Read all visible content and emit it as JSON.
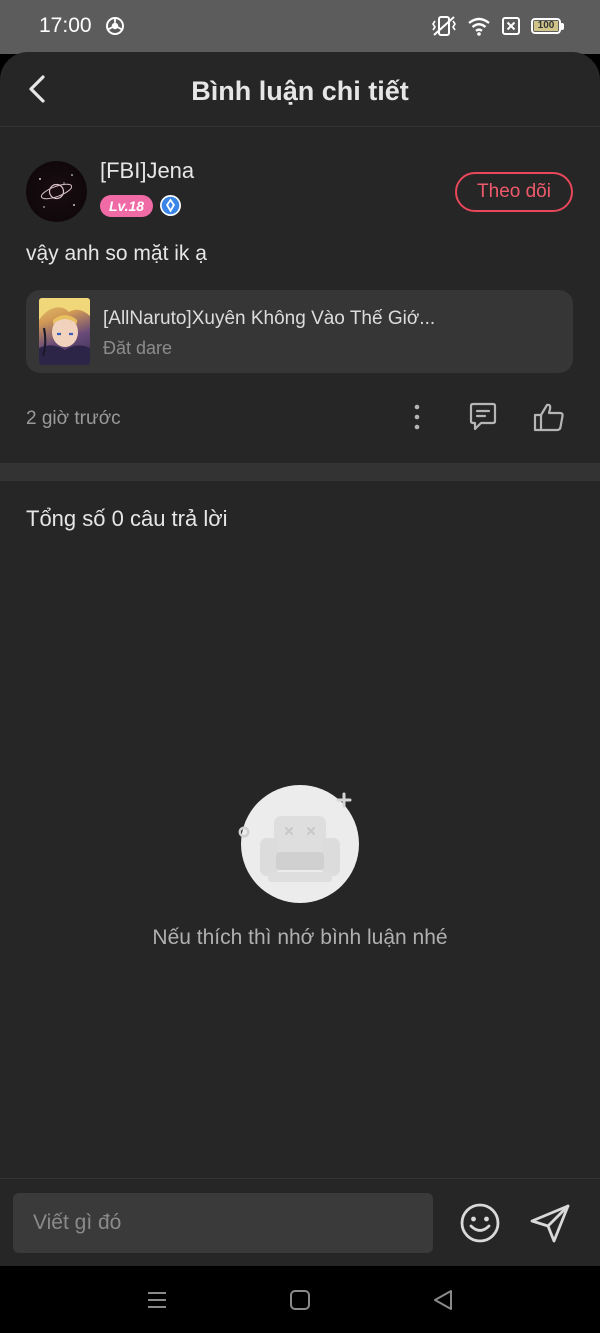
{
  "status_bar": {
    "time": "17:00",
    "battery": "100",
    "icons": [
      "chrome-icon",
      "vibrate-icon",
      "wifi-icon",
      "sim-blocked-icon",
      "battery-icon"
    ]
  },
  "header": {
    "title": "Bình luận chi tiết",
    "back_icon": "back-arrow-icon"
  },
  "comment": {
    "username": "[FBI]Jena",
    "level": "Lv.18",
    "follow_label": "Theo dõi",
    "text": "vậy anh so mặt ik ạ",
    "book": {
      "title": "[AllNaruto]Xuyên Không Vào Thế Giớ...",
      "subtitle": "Đăt dare"
    },
    "time_ago": "2 giờ trước",
    "actions": [
      "more-options-icon",
      "reply-icon",
      "like-icon"
    ]
  },
  "replies": {
    "count_label": "Tổng số 0 câu trả lời",
    "empty_message": "Nếu thích thì nhớ bình luận nhé"
  },
  "input_bar": {
    "placeholder": "Viết gì đó",
    "emoji_icon": "emoji-icon",
    "send_icon": "send-icon"
  },
  "colors": {
    "background": "#262626",
    "accent_follow": "#e8475a",
    "level_badge": "#f06aa5",
    "vip_badge": "#3a86e8"
  }
}
